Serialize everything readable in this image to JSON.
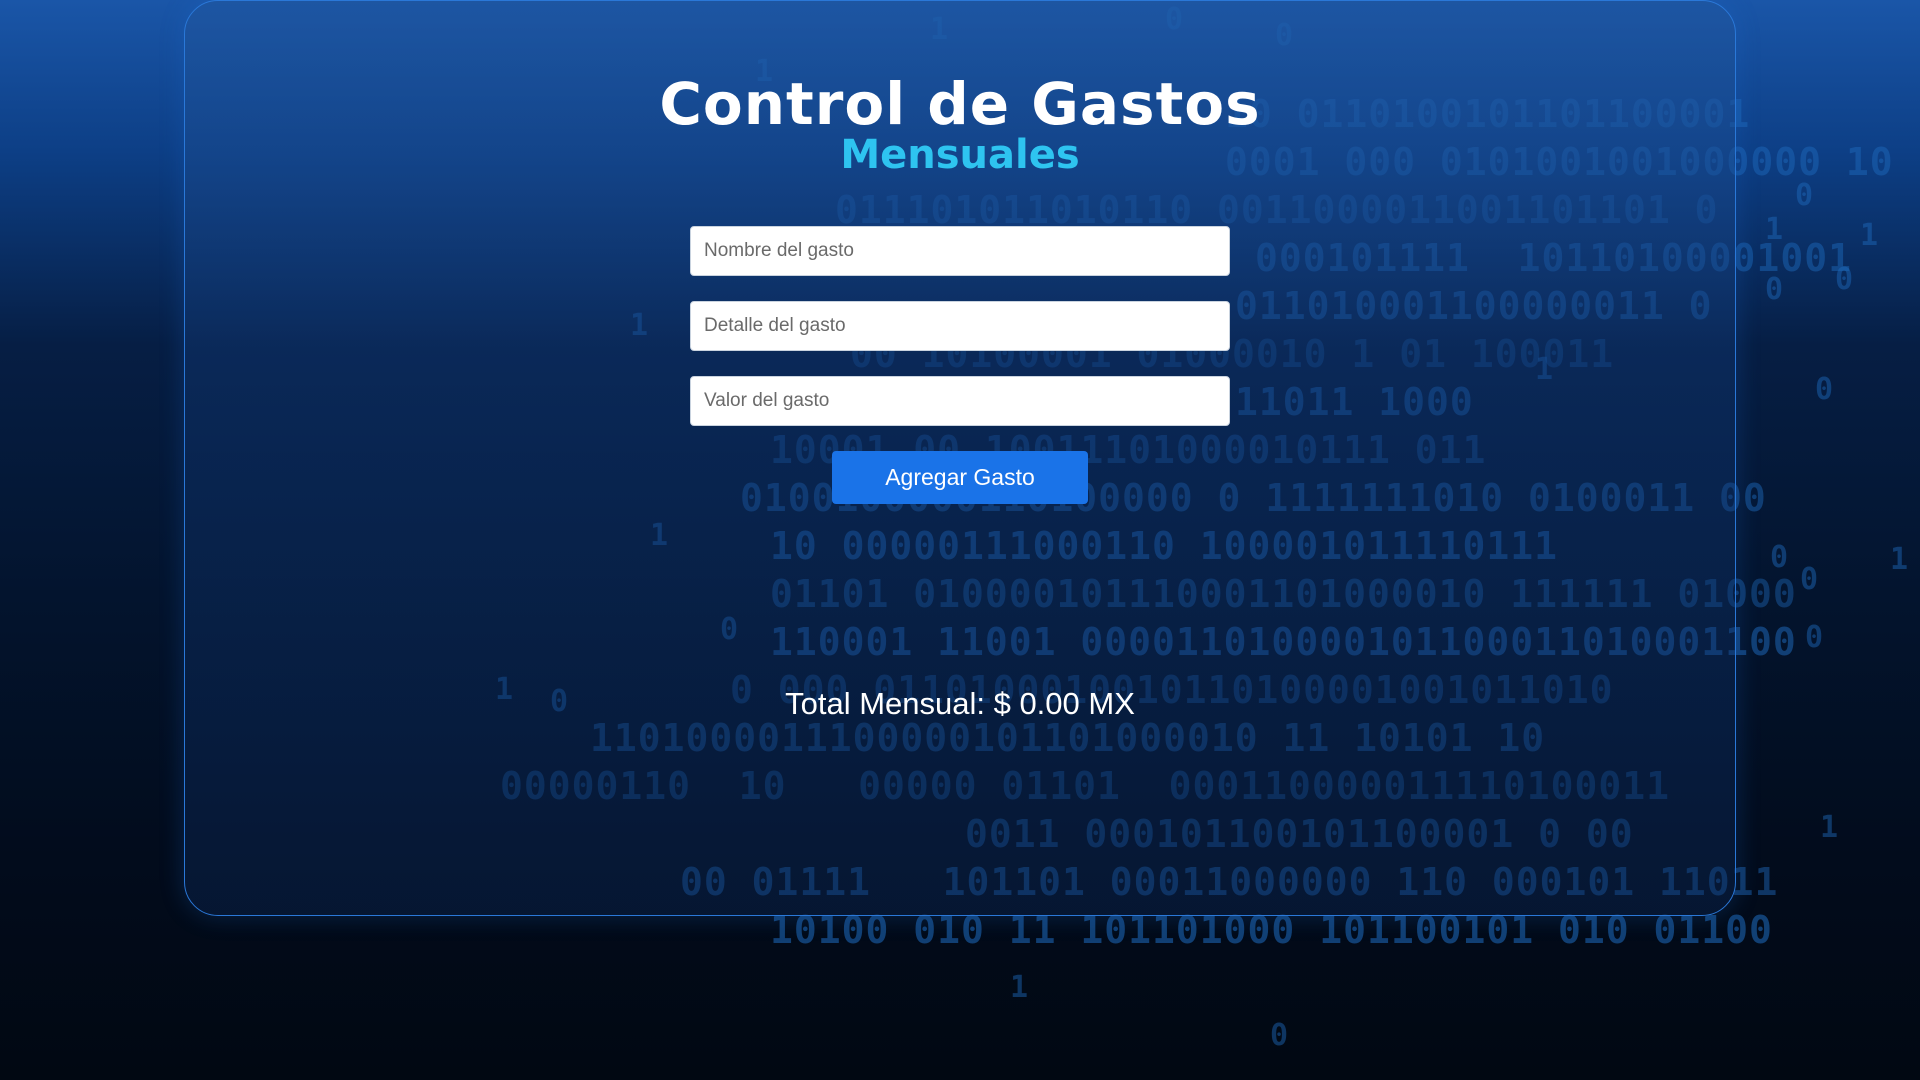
{
  "app": {
    "title": "Control de Gastos",
    "subtitle": "Mensuales"
  },
  "form": {
    "name_placeholder": "Nombre del gasto",
    "detail_placeholder": "Detalle del gasto",
    "value_placeholder": "Valor del gasto",
    "submit_label": "Agregar Gasto"
  },
  "summary": {
    "total_text": "Total Mensual: $ 0.00 MX"
  },
  "background": {
    "binary_rows": [
      "10 0110100101101100001",
      "0001 000 0101001001000000 10",
      "011101011010110 0011000011001101101 0",
      "000101111  10110100001001",
      "011010001100000011 0",
      "00 10100001 01000010 1 01 100011",
      "11011 1000",
      "10001 00 10011101000010111 011",
      "0100100000110100000 0 1111111010 0100011 00",
      "10 00000111000110 100001011110111",
      "01101 010000101110001101000010 111111 01000",
      "110001 11001 000011010000101100011010001100",
      "0 000 0110100010010110100001001011010",
      "1101000011100000101101000010 11 10101 10",
      "00000110  10   00000 01101  000110000011110100011",
      "0011 000101100101100001 0 00",
      "00 01111   101101 00011000000 110 000101 11011",
      "10100 010 11 101101000 101100101 010 01100"
    ],
    "stray_digits": [
      "1",
      "0",
      "0",
      "1",
      "0",
      "1",
      "1",
      "0",
      "0",
      "1",
      "0",
      "1",
      "1",
      "0",
      "0",
      "1",
      "0",
      "0",
      "1",
      "0",
      "1",
      "1",
      "0"
    ]
  },
  "colors": {
    "accent": "#2ec4f0",
    "button": "#1a73e8",
    "card_border": "#2a78d8",
    "matrix_digits": "#1f6cbf"
  }
}
